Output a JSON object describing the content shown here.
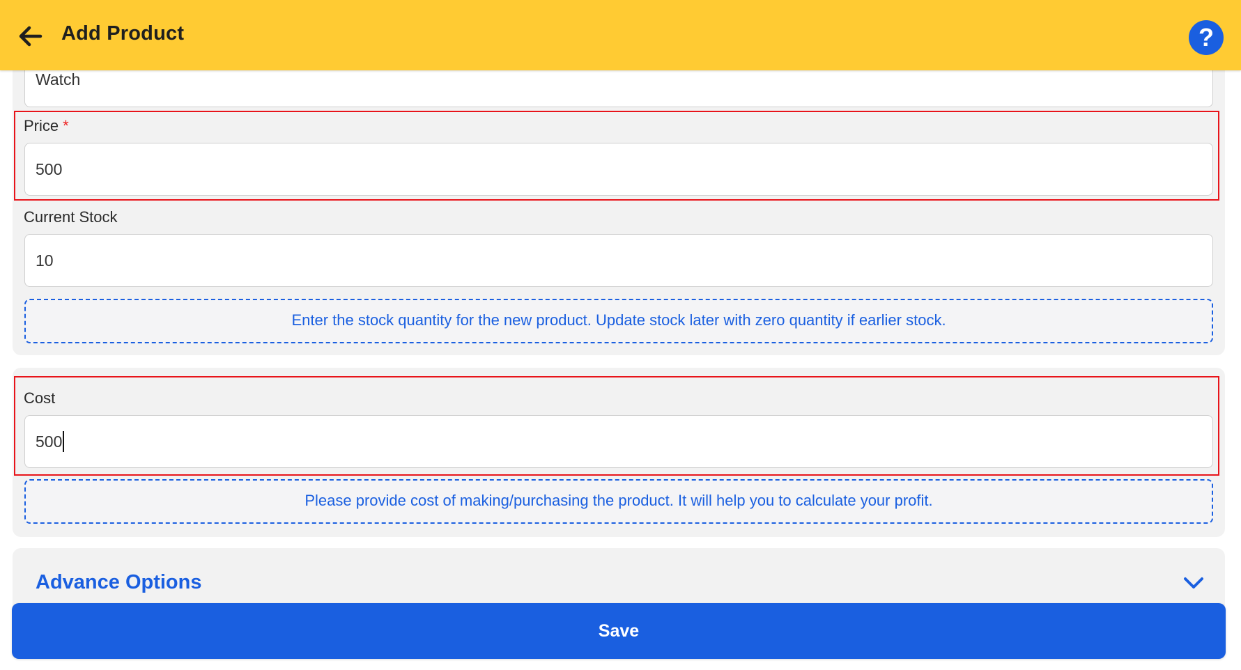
{
  "header": {
    "title": "Add Product",
    "back_icon": "arrow-left-icon",
    "help_label": "?",
    "help_icon": "help-circle-icon",
    "background_color": "#ffcb33"
  },
  "form": {
    "name_value": "Watch",
    "price": {
      "label": "Price",
      "required_mark": "*",
      "value": "500"
    },
    "stock": {
      "label": "Current Stock",
      "value": "10",
      "hint": "Enter the stock quantity for the new product. Update stock later with zero quantity if earlier stock."
    },
    "cost": {
      "label": "Cost",
      "value": "500",
      "hint": "Please provide cost of making/purchasing the product. It will help you to calculate your profit."
    },
    "advance_options": {
      "label": "Advance Options",
      "icon": "chevron-down-icon"
    }
  },
  "footer": {
    "save_label": "Save"
  },
  "colors": {
    "accent": "#1a5fe0",
    "highlight": "#e8141a",
    "required": "#e22222"
  }
}
